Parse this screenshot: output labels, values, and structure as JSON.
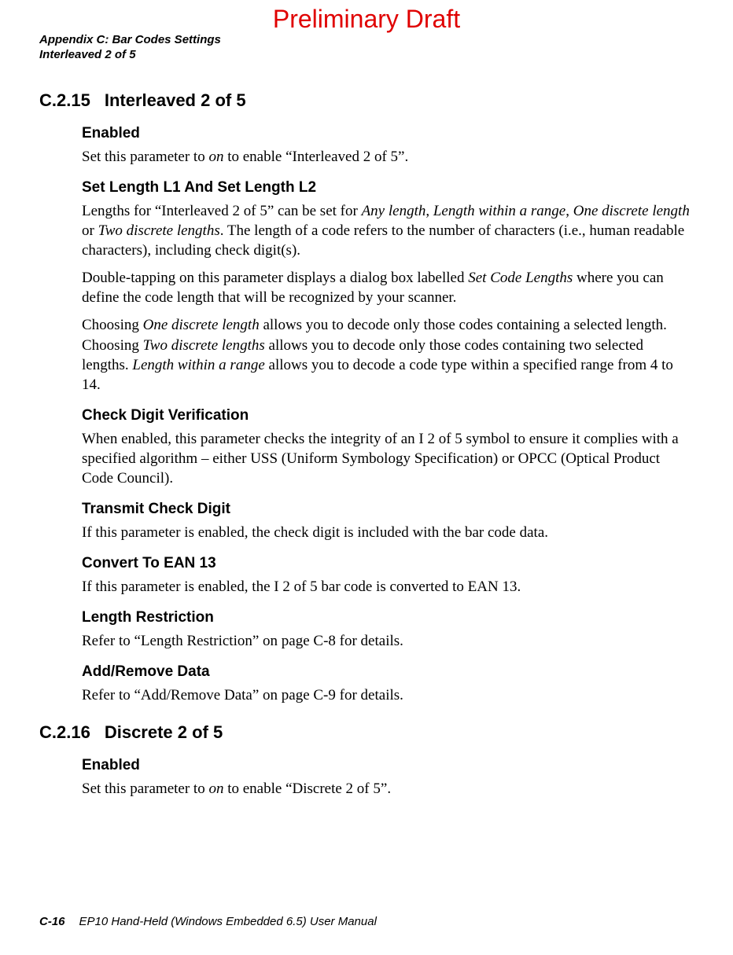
{
  "watermark": "Preliminary Draft",
  "runningHead": {
    "line1": "Appendix C: Bar Codes Settings",
    "line2": "Interleaved 2 of 5"
  },
  "sections": {
    "s1": {
      "num": "C.2.15",
      "title": "Interleaved 2 of 5",
      "enabled": {
        "heading": "Enabled",
        "p1a": "Set this parameter to ",
        "p1b": "on",
        "p1c": " to enable “Interleaved 2 of 5”."
      },
      "setlen": {
        "heading": "Set Length L1 And Set Length L2",
        "p1a": "Lengths for “Interleaved 2 of 5” can be set for ",
        "p1b": "Any length",
        "p1c": ", ",
        "p1d": "Length within a range",
        "p1e": ", ",
        "p1f": "One discrete length",
        "p1g": " or ",
        "p1h": "Two discrete lengths",
        "p1i": ". The length of a code refers to the number of characters (i.e., human readable characters), including check digit(s).",
        "p2a": "Double-tapping on this parameter displays a dialog box labelled ",
        "p2b": "Set Code Lengths",
        "p2c": " where you can define the code length that will be recognized by your scanner.",
        "p3a": "Choosing ",
        "p3b": "One discrete length",
        "p3c": " allows you to decode only those codes containing a selected length. Choosing ",
        "p3d": "Two discrete lengths",
        "p3e": " allows you to decode only those codes containing two selected lengths. ",
        "p3f": "Length within a range",
        "p3g": " allows you to decode a code type within a specified range from 4 to 14."
      },
      "cdv": {
        "heading": "Check Digit Verification",
        "p1": "When enabled, this parameter checks the integrity of an I 2 of 5 symbol to ensure it complies with a specified algorithm – either USS (Uniform Symbology Specification) or OPCC (Optical Product Code Council)."
      },
      "tcd": {
        "heading": "Transmit Check Digit",
        "p1": "If this parameter is enabled, the check digit is included with the bar code data."
      },
      "cte": {
        "heading": "Convert To EAN 13",
        "p1": "If this parameter is enabled, the I 2 of 5 bar code is converted to EAN 13."
      },
      "lr": {
        "heading": "Length Restriction",
        "p1": "Refer to “Length Restriction” on page C-8 for details."
      },
      "ard": {
        "heading": "Add/Remove Data",
        "p1": "Refer to “Add/Remove Data” on page C-9 for details."
      }
    },
    "s2": {
      "num": "C.2.16",
      "title": "Discrete 2 of 5",
      "enabled": {
        "heading": "Enabled",
        "p1a": "Set this parameter to ",
        "p1b": "on",
        "p1c": " to enable “Discrete 2 of 5”."
      }
    }
  },
  "footer": {
    "pagenum": "C-16",
    "title": "EP10 Hand-Held (Windows Embedded 6.5) User Manual"
  }
}
